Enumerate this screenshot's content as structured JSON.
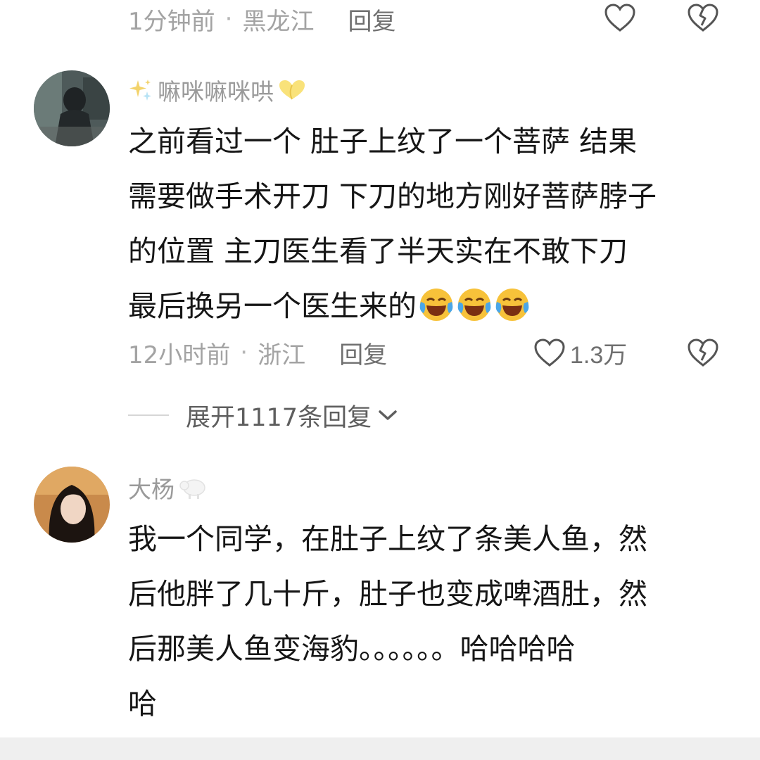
{
  "top_meta": {
    "time": "1分钟前",
    "location": "黑龙江",
    "reply_label": "回复"
  },
  "comment1": {
    "username_prefix_icon": "sparkle-icon",
    "username": "嘛咪嘛咪哄",
    "username_suffix_icon": "yellow-heart-hands-icon",
    "lines": [
      "之前看过一个  肚子上纹了一个菩萨  结果",
      "需要做手术开刀  下刀的地方刚好菩萨脖子",
      "的位置  主刀医生看了半天实在不敢下刀",
      "最后换另一个医生来的"
    ],
    "emoji_icon": "laughing-crying-emoji",
    "time": "12小时前",
    "location": "浙江",
    "reply_label": "回复",
    "like_count": "1.3万"
  },
  "expand_replies": "展开1117条回复",
  "comment2": {
    "username": "大杨",
    "username_suffix_icon": "sheep-icon",
    "lines": [
      "我一个同学，在肚子上纹了条美人鱼，然",
      "后他胖了几十斤，肚子也变成啤酒肚，然",
      "后那美人鱼变海豹。。。。。。哈哈哈哈",
      "哈"
    ]
  },
  "colors": {
    "meta_gray": "#a3a3a3",
    "reply_gray": "#6f6f6f",
    "text_black": "#161616",
    "emoji_yellow": "#f7c23a",
    "tear_blue": "#4aa6e8"
  }
}
